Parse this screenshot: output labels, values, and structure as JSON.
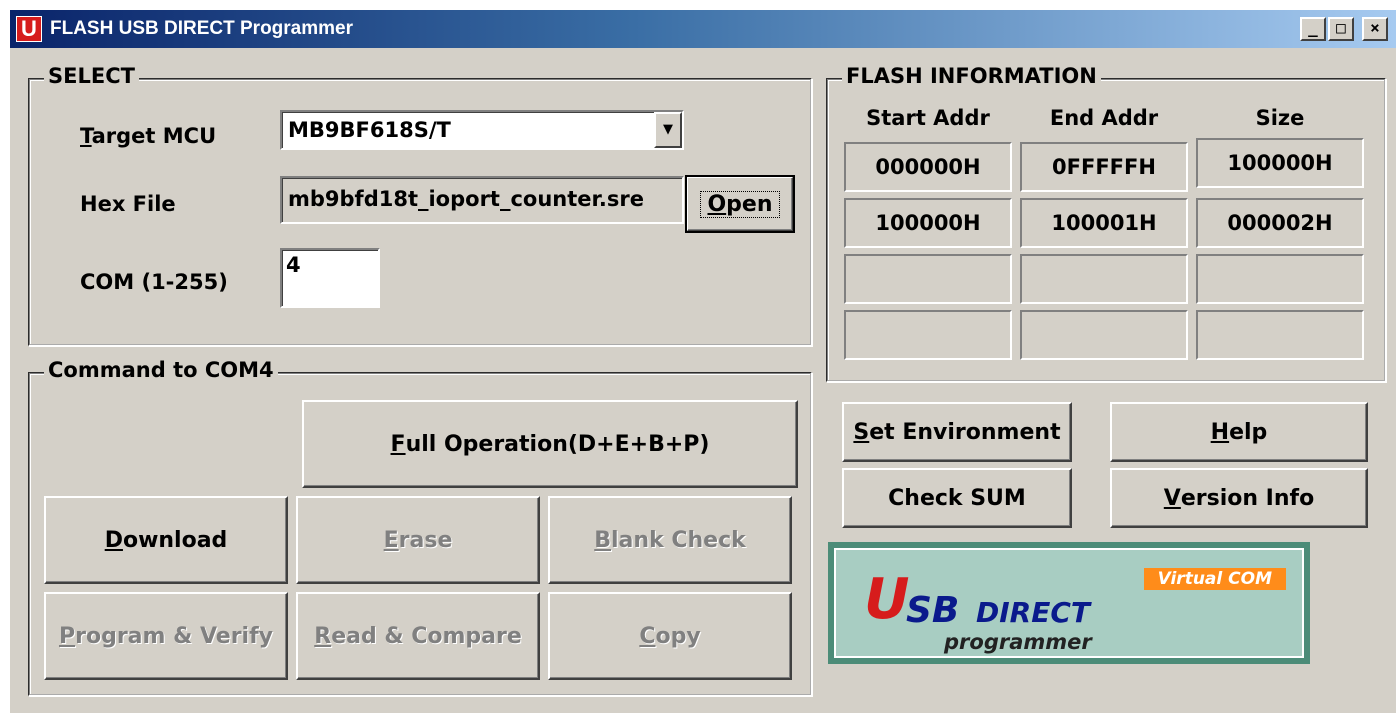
{
  "window": {
    "icon_letter": "U",
    "title": "FLASH USB DIRECT Programmer",
    "minimize": "_",
    "maximize": "□",
    "close": "×"
  },
  "select": {
    "title": "SELECT",
    "target_mcu_label_mn": "T",
    "target_mcu_label_rest": "arget MCU",
    "target_mcu_value": "MB9BF618S/T",
    "hex_file_label": "Hex File",
    "hex_file_value": "mb9bfd18t_ioport_counter.sre",
    "open_mn": "O",
    "open_rest": "pen",
    "com_label": "COM (1-255)",
    "com_value": "4"
  },
  "flash_info": {
    "title": "FLASH INFORMATION",
    "columns": [
      "Start Addr",
      "End Addr",
      "Size"
    ],
    "rows": [
      [
        "000000H",
        "0FFFFFH",
        "100000H"
      ],
      [
        "100000H",
        "100001H",
        "000002H"
      ],
      [
        "",
        "",
        ""
      ],
      [
        "",
        "",
        ""
      ]
    ]
  },
  "command": {
    "title": "Command  to  COM4",
    "full_operation_mn": "F",
    "full_operation_rest": "ull Operation(D+E+B+P)",
    "download_mn": "D",
    "download_rest": "ownload",
    "erase_mn": "E",
    "erase_rest": "rase",
    "blank_check_mn": "B",
    "blank_check_rest": "lank Check",
    "program_verify_mn": "P",
    "program_verify_rest": "rogram & Verify",
    "read_compare_mn": "R",
    "read_compare_rest": "ead & Compare",
    "copy_mn": "C",
    "copy_rest": "opy"
  },
  "side_buttons": {
    "set_env_mn": "S",
    "set_env_rest": "et Environment",
    "help_mn": "H",
    "help_rest": "elp",
    "check_sum": "Check SUM",
    "version_mn": "V",
    "version_rest": "ersion Info"
  },
  "logo": {
    "virtual_com": "Virtual COM",
    "u": "U",
    "sb": "SB",
    "direct": "DIRECT",
    "programmer": "programmer"
  },
  "colors": {
    "face": "#d4d0c8",
    "title_start": "#0a246a",
    "title_end": "#a6caf0",
    "logo_bg": "#a8cdc2",
    "logo_orange": "#ff8c1a",
    "logo_red": "#d61c1c",
    "logo_blue": "#0a1a8c"
  }
}
